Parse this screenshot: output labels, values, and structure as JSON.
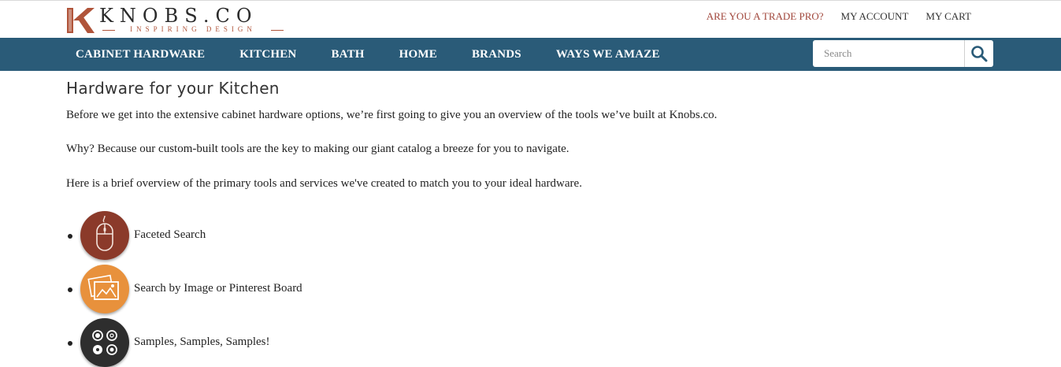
{
  "brand": {
    "name": "KNOBS.CO",
    "tagline": "INSPIRING DESIGN",
    "accent_color": "#b0543a"
  },
  "top_links": [
    {
      "label": "ARE YOU A TRADE PRO?"
    },
    {
      "label": "MY ACCOUNT"
    },
    {
      "label": "MY CART"
    }
  ],
  "nav": {
    "background": "#2a5b78",
    "items": [
      {
        "label": "CABINET HARDWARE"
      },
      {
        "label": "KITCHEN"
      },
      {
        "label": "BATH"
      },
      {
        "label": "HOME"
      },
      {
        "label": "BRANDS"
      },
      {
        "label": "WAYS WE AMAZE"
      }
    ],
    "search": {
      "placeholder": "Search",
      "icon": "search-icon"
    }
  },
  "main": {
    "title": "Hardware for your Kitchen",
    "paragraphs": [
      "Before we get into the extensive cabinet hardware options, we’re first going to give you an overview of the tools we’ve built at Knobs.co.",
      "Why? Because our custom-built tools are the key to making our giant catalog a breeze for you to navigate.",
      "Here is a brief overview of the primary tools and services we've created to match you to your ideal hardware."
    ],
    "tools": [
      {
        "label": "Faceted Search",
        "icon": "mouse-icon",
        "color": "#8b3a2a"
      },
      {
        "label": "Search by Image or Pinterest Board",
        "icon": "photos-icon",
        "color": "#e8913c"
      },
      {
        "label": "Samples, Samples, Samples!",
        "icon": "samples-icon",
        "color": "#2e2e2e"
      }
    ]
  }
}
